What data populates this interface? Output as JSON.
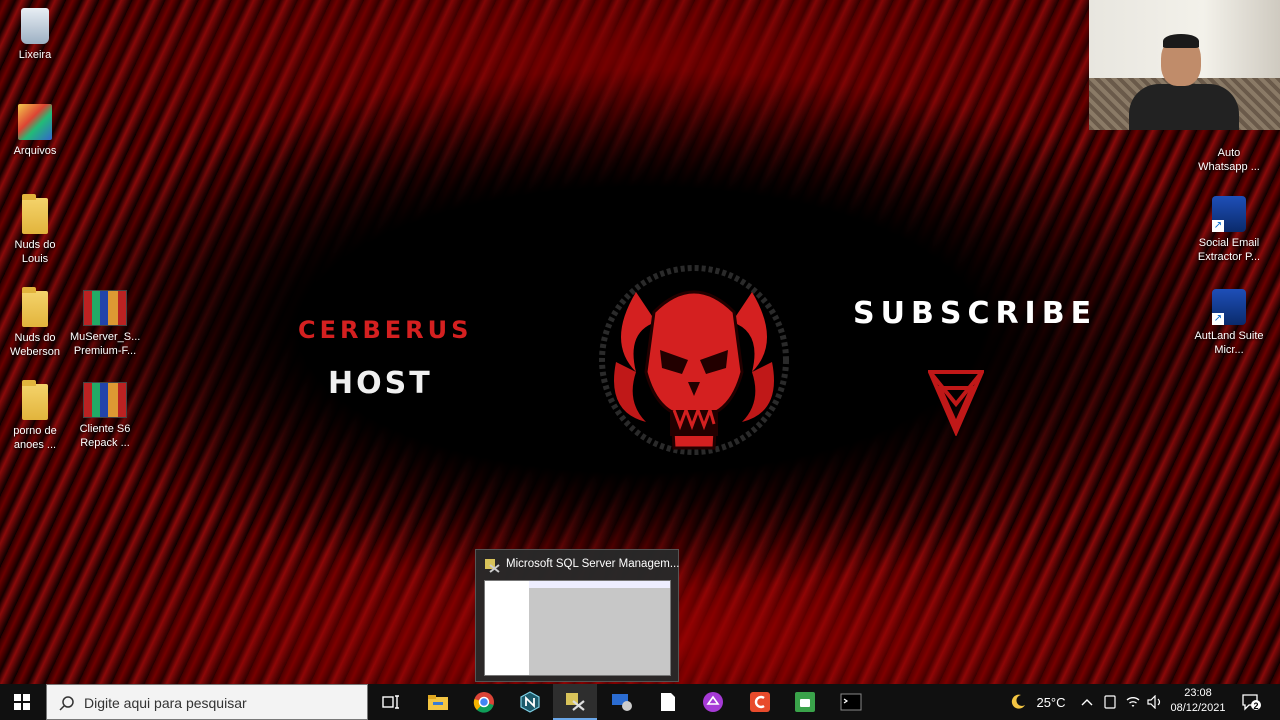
{
  "desktop_icons_left": [
    {
      "label": "Lixeira",
      "icon": "recycle-bin-icon"
    },
    {
      "label": "Arquivos",
      "icon": "archive-icon"
    },
    {
      "label": "Nuds do Louis",
      "icon": "folder-icon"
    },
    {
      "label": "Nuds do Weberson",
      "icon": "folder-icon"
    },
    {
      "label": "MuServer_S... Premium-F...",
      "icon": "winrar-icon"
    },
    {
      "label": "porno de anoes ...",
      "icon": "folder-icon"
    },
    {
      "label": "Cliente S6 Repack ...",
      "icon": "winrar-icon"
    }
  ],
  "desktop_icons_right": [
    {
      "label": "Auto Whatsapp ...",
      "icon": "shortcut-app-icon"
    },
    {
      "label": "Social Email Extractor P...",
      "icon": "shortcut-app-icon"
    },
    {
      "label": "AutLand Suite Micr...",
      "icon": "shortcut-app-icon"
    }
  ],
  "wallpaper": {
    "brand_line1": "CERBERUS",
    "brand_line2": "HOST",
    "subscribe": "SUBSCRIBE",
    "accent_color": "#d42020"
  },
  "taskbar_thumbnail": {
    "title": "Microsoft SQL Server Managem..."
  },
  "taskbar": {
    "search_placeholder": "Digite aqui para pesquisar",
    "apps": [
      "task-view-icon",
      "file-explorer-icon",
      "chrome-icon",
      "app-n-icon",
      "sql-server-management-icon",
      "remote-desktop-icon",
      "notepad-icon",
      "app-purple-icon",
      "app-c-icon",
      "android-icon",
      "terminal-icon"
    ],
    "weather": "25°C",
    "time": "23:08",
    "date": "08/12/2021",
    "notification_count": "2"
  }
}
